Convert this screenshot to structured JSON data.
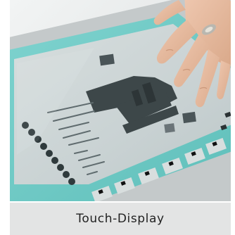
{
  "caption": "Touch-Display"
}
